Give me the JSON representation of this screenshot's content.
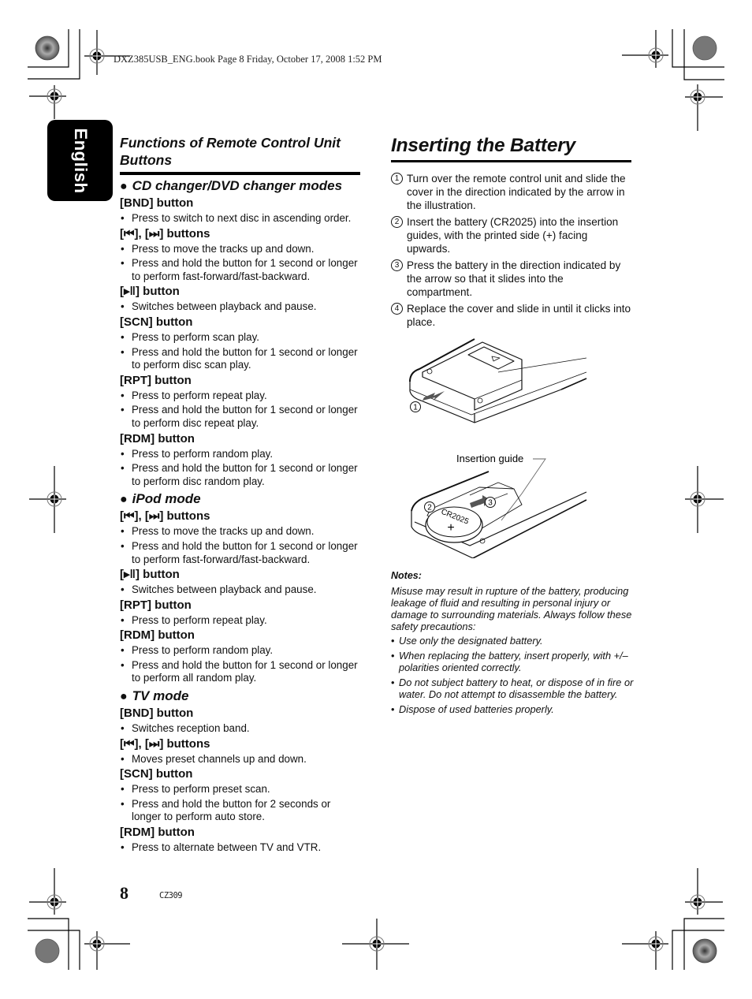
{
  "header": {
    "print_info": "DXZ385USB_ENG.book  Page 8  Friday, October 17, 2008  1:52 PM"
  },
  "language_tab": "English",
  "left": {
    "title": "Functions of Remote Control Unit Buttons",
    "modes": [
      {
        "name": "CD changer/DVD changer modes",
        "buttons": [
          {
            "label": "[BND] button",
            "items": [
              "Press to switch to next disc in ascending order."
            ]
          },
          {
            "label": "[⏮︎], [⏭︎] buttons",
            "items": [
              "Press to move the tracks up and down.",
              "Press and hold the button for 1 second or longer to perform fast-forward/fast-backward."
            ]
          },
          {
            "label": "[▸‖] button",
            "items": [
              "Switches between playback and pause."
            ]
          },
          {
            "label": "[SCN] button",
            "items": [
              "Press to perform scan play.",
              "Press and hold the button for 1 second or longer to perform disc scan play."
            ]
          },
          {
            "label": "[RPT] button",
            "items": [
              "Press to perform repeat play.",
              "Press and hold the button for 1 second or longer to perform disc repeat play."
            ]
          },
          {
            "label": "[RDM] button",
            "items": [
              "Press to perform random play.",
              "Press and hold the button for 1 second or longer to perform disc random play."
            ]
          }
        ]
      },
      {
        "name": "iPod mode",
        "buttons": [
          {
            "label": "[⏮︎], [⏭︎] buttons",
            "items": [
              "Press to move the tracks up and down.",
              "Press and hold the button for 1 second or longer to perform fast-forward/fast-backward."
            ]
          },
          {
            "label": "[▸‖] button",
            "items": [
              "Switches between playback and pause."
            ]
          },
          {
            "label": "[RPT] button",
            "items": [
              "Press to perform repeat play."
            ]
          },
          {
            "label": "[RDM] button",
            "items": [
              "Press to perform random play.",
              "Press and hold the button for 1 second or longer to perform all random play."
            ]
          }
        ]
      },
      {
        "name": "TV mode",
        "buttons": [
          {
            "label": "[BND] button",
            "items": [
              "Switches reception band."
            ]
          },
          {
            "label": "[⏮︎], [⏭︎] buttons",
            "items": [
              "Moves preset channels up and down."
            ]
          },
          {
            "label": "[SCN] button",
            "items": [
              "Press to perform preset scan.",
              "Press and hold the button for 2 seconds or longer to perform auto store."
            ]
          },
          {
            "label": "[RDM] button",
            "items": [
              "Press to alternate between TV and VTR."
            ]
          }
        ]
      }
    ]
  },
  "right": {
    "title": "Inserting the Battery",
    "steps": [
      {
        "num": "1",
        "text": "Turn over the remote control unit and slide the cover in the direction indicated by the arrow in the illustration."
      },
      {
        "num": "2",
        "text": "Insert the battery (CR2025) into the insertion guides, with the printed side (+) facing upwards."
      },
      {
        "num": "3",
        "text": "Press the battery in the direction indicated by the arrow so that it slides into the compartment."
      },
      {
        "num": "4",
        "text": "Replace the cover and slide in until it clicks into place."
      }
    ],
    "figure1": {
      "callout": "1"
    },
    "figure2": {
      "label": "Insertion guide",
      "callout_a": "2",
      "callout_b": "3",
      "battery_text": "CR2025",
      "battery_sign": "+"
    },
    "notes": {
      "title": "Notes:",
      "intro": "Misuse may result in rupture of the battery, producing leakage of fluid and resulting in personal injury or damage to surrounding materials. Always follow these safety precautions:",
      "items": [
        "Use only the designated battery.",
        "When replacing the battery, insert properly, with +/– polarities oriented correctly.",
        "Do not subject battery to heat, or dispose of in fire or water. Do not attempt to disassemble the battery.",
        "Dispose of used batteries properly."
      ]
    }
  },
  "footer": {
    "page_number": "8",
    "code": "CZ309"
  }
}
